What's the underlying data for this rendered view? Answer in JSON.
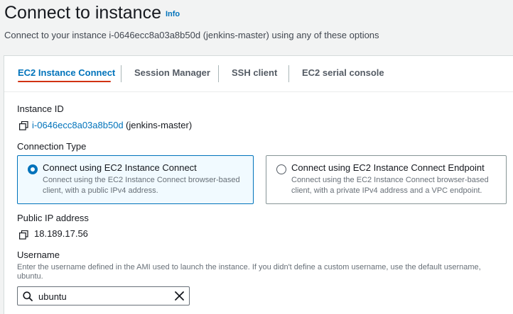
{
  "header": {
    "title": "Connect to instance",
    "info_label": "Info",
    "description": "Connect to your instance i-0646ecc8a03a8b50d (jenkins-master) using any of these options"
  },
  "tabs": [
    {
      "label": "EC2 Instance Connect",
      "active": true
    },
    {
      "label": "Session Manager",
      "active": false
    },
    {
      "label": "SSH client",
      "active": false
    },
    {
      "label": "EC2 serial console",
      "active": false
    }
  ],
  "instance": {
    "label": "Instance ID",
    "id": "i-0646ecc8a03a8b50d",
    "name": "(jenkins-master)"
  },
  "connection_type": {
    "label": "Connection Type",
    "options": [
      {
        "title": "Connect using EC2 Instance Connect",
        "description": "Connect using the EC2 Instance Connect browser-based client, with a public IPv4 address.",
        "selected": true
      },
      {
        "title": "Connect using EC2 Instance Connect Endpoint",
        "description": "Connect using the EC2 Instance Connect browser-based client, with a private IPv4 address and a VPC endpoint.",
        "selected": false
      }
    ]
  },
  "public_ip": {
    "label": "Public IP address",
    "value": "18.189.17.56"
  },
  "username": {
    "label": "Username",
    "hint": "Enter the username defined in the AMI used to launch the instance. If you didn't define a custom username, use the default username, ubuntu.",
    "value": "ubuntu"
  },
  "colors": {
    "accent": "#0073bb",
    "tab_underline": "#d13212",
    "selected_tile_bg": "#f1faff"
  },
  "icons": [
    "copy-icon",
    "search-icon",
    "clear-icon"
  ]
}
